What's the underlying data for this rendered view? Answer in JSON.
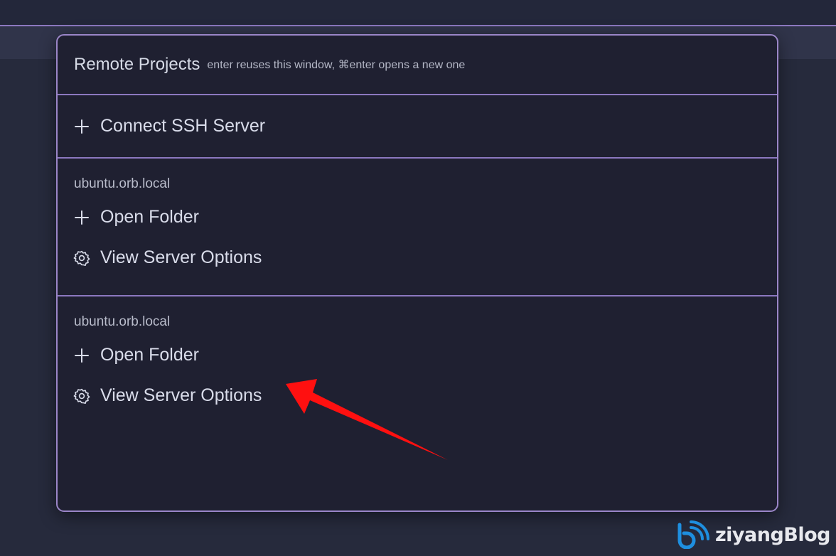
{
  "modal": {
    "title": "Remote Projects",
    "hint": "enter reuses this window, ⌘enter opens a new one",
    "connect_ssh_label": "Connect SSH Server",
    "servers": [
      {
        "host": "ubuntu.orb.local",
        "open_folder_label": "Open Folder",
        "view_options_label": "View Server Options"
      },
      {
        "host": "ubuntu.orb.local",
        "open_folder_label": "Open Folder",
        "view_options_label": "View Server Options"
      }
    ]
  },
  "icons": {
    "plus": "plus-icon",
    "gear": "gear-icon",
    "arrow": "red-arrow-annotation"
  },
  "colors": {
    "background": "#262a3c",
    "modal_background": "#1f2031",
    "border_accent": "#9b86c8",
    "arrow": "#ff1010"
  },
  "watermark": {
    "text": "ziyangBlog"
  }
}
